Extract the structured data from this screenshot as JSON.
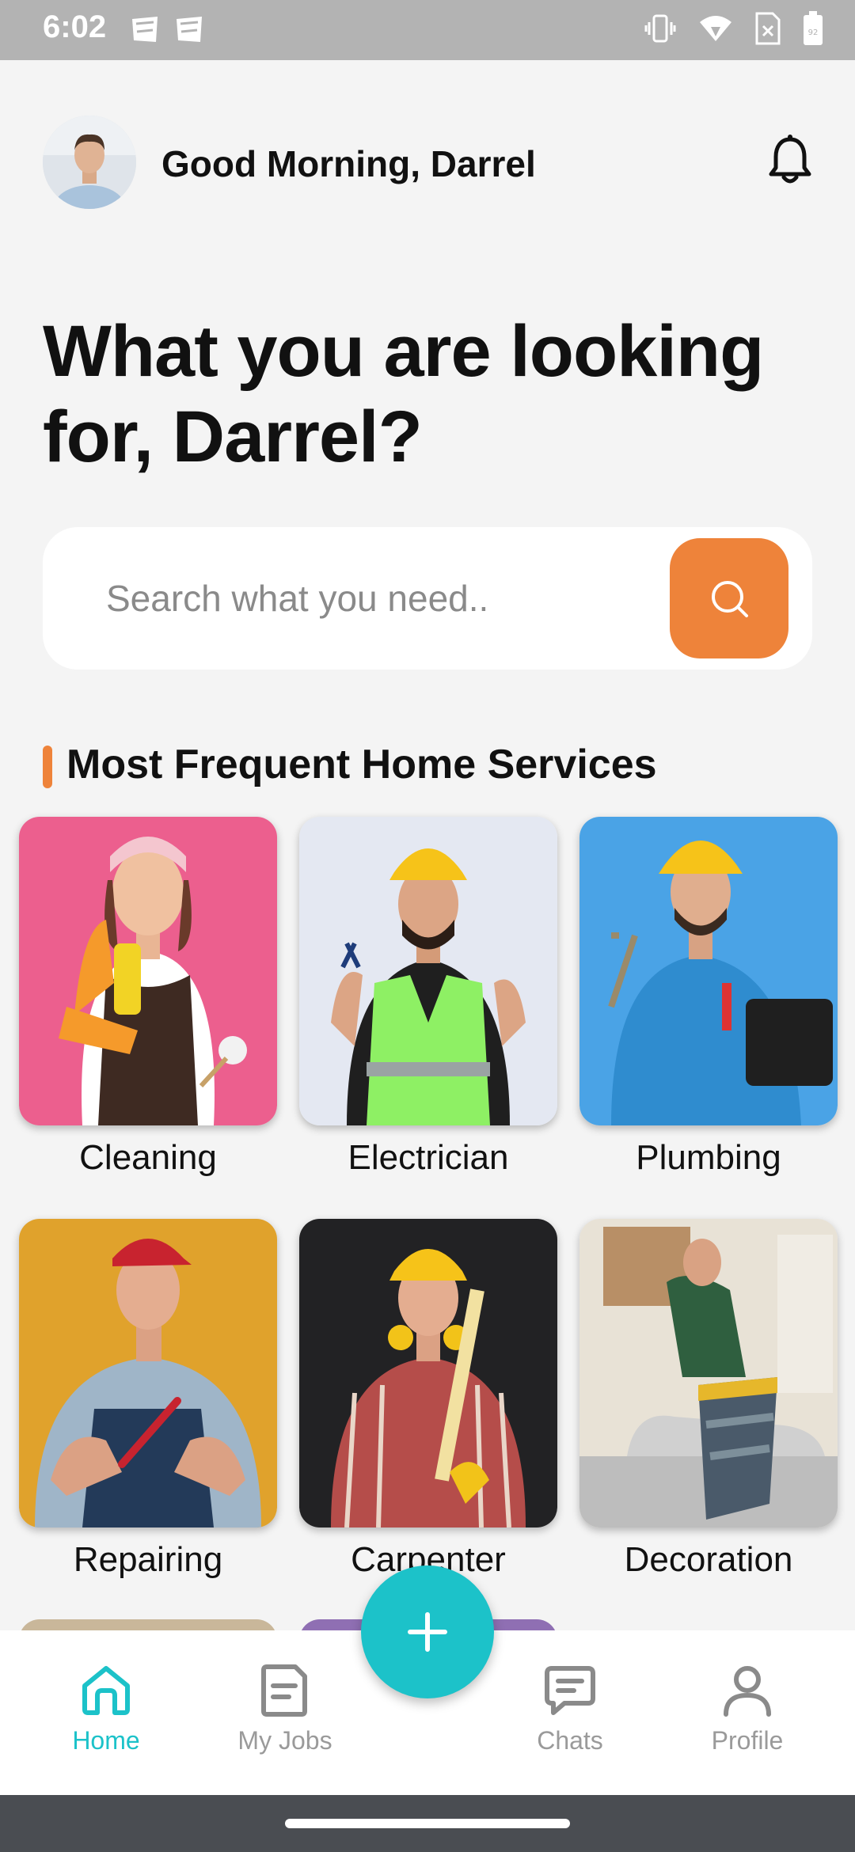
{
  "status": {
    "time": "6:02",
    "battery": "92"
  },
  "header": {
    "greeting": "Good Morning, Darrel"
  },
  "headline": "What you are looking for, Darrel?",
  "search": {
    "placeholder": "Search what you need.."
  },
  "section": {
    "title": "Most Frequent Home Services"
  },
  "services": [
    {
      "label": "Cleaning"
    },
    {
      "label": "Electrician"
    },
    {
      "label": "Plumbing"
    },
    {
      "label": "Repairing"
    },
    {
      "label": "Carpenter"
    },
    {
      "label": "Decoration"
    }
  ],
  "nav": {
    "home": "Home",
    "jobs": "My Jobs",
    "chats": "Chats",
    "profile": "Profile"
  },
  "colors": {
    "accent": "#ee833a",
    "primary": "#1cc2c9"
  }
}
